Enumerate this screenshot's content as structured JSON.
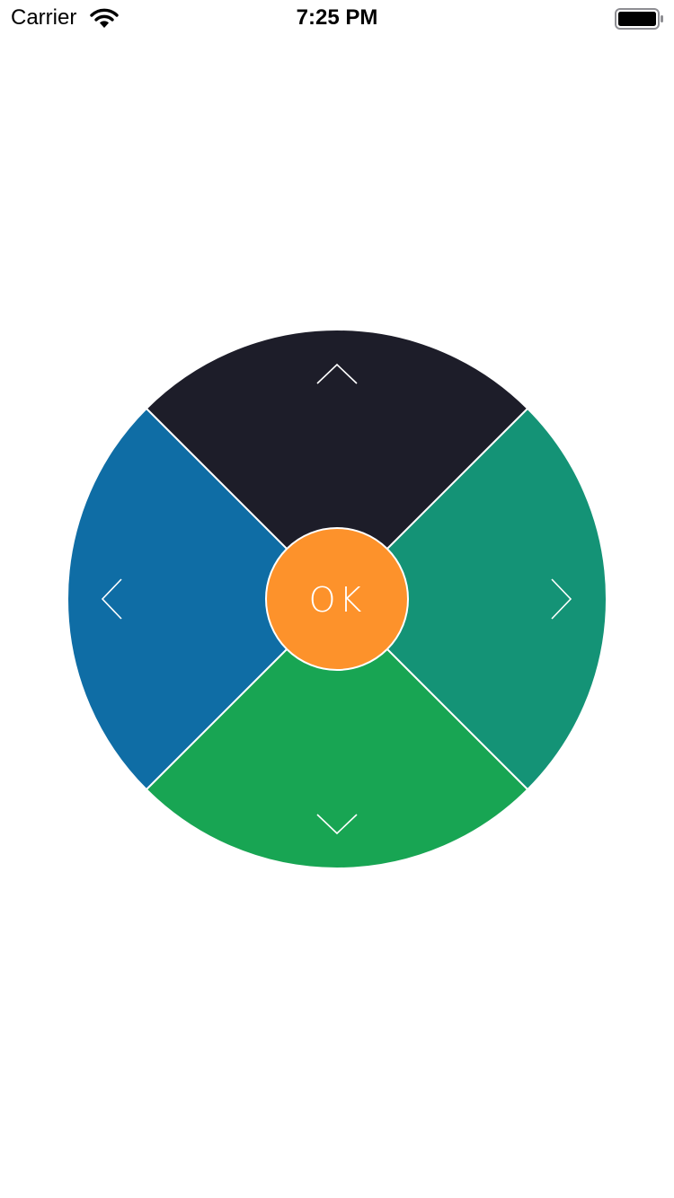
{
  "status_bar": {
    "carrier": "Carrier",
    "time": "7:25 PM",
    "icons": [
      "wifi-icon",
      "battery-icon"
    ]
  },
  "dpad": {
    "ok_label": "OK",
    "icons": {
      "up": "chevron-up-icon",
      "down": "chevron-down-icon",
      "left": "chevron-left-icon",
      "right": "chevron-right-icon"
    },
    "colors": {
      "up": "#1d1d29",
      "right": "#149376",
      "down": "#18a553",
      "left": "#0f6da5",
      "center": "#fd922b",
      "stroke": "#ffffff"
    }
  }
}
